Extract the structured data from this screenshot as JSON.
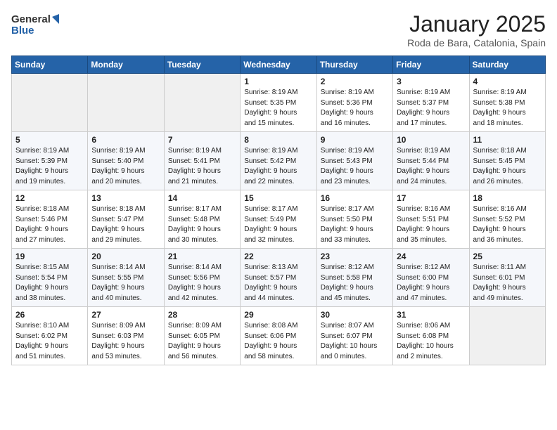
{
  "header": {
    "logo_general": "General",
    "logo_blue": "Blue",
    "month_title": "January 2025",
    "location": "Roda de Bara, Catalonia, Spain"
  },
  "days_of_week": [
    "Sunday",
    "Monday",
    "Tuesday",
    "Wednesday",
    "Thursday",
    "Friday",
    "Saturday"
  ],
  "weeks": [
    [
      {
        "day": "",
        "info": ""
      },
      {
        "day": "",
        "info": ""
      },
      {
        "day": "",
        "info": ""
      },
      {
        "day": "1",
        "info": "Sunrise: 8:19 AM\nSunset: 5:35 PM\nDaylight: 9 hours\nand 15 minutes."
      },
      {
        "day": "2",
        "info": "Sunrise: 8:19 AM\nSunset: 5:36 PM\nDaylight: 9 hours\nand 16 minutes."
      },
      {
        "day": "3",
        "info": "Sunrise: 8:19 AM\nSunset: 5:37 PM\nDaylight: 9 hours\nand 17 minutes."
      },
      {
        "day": "4",
        "info": "Sunrise: 8:19 AM\nSunset: 5:38 PM\nDaylight: 9 hours\nand 18 minutes."
      }
    ],
    [
      {
        "day": "5",
        "info": "Sunrise: 8:19 AM\nSunset: 5:39 PM\nDaylight: 9 hours\nand 19 minutes."
      },
      {
        "day": "6",
        "info": "Sunrise: 8:19 AM\nSunset: 5:40 PM\nDaylight: 9 hours\nand 20 minutes."
      },
      {
        "day": "7",
        "info": "Sunrise: 8:19 AM\nSunset: 5:41 PM\nDaylight: 9 hours\nand 21 minutes."
      },
      {
        "day": "8",
        "info": "Sunrise: 8:19 AM\nSunset: 5:42 PM\nDaylight: 9 hours\nand 22 minutes."
      },
      {
        "day": "9",
        "info": "Sunrise: 8:19 AM\nSunset: 5:43 PM\nDaylight: 9 hours\nand 23 minutes."
      },
      {
        "day": "10",
        "info": "Sunrise: 8:19 AM\nSunset: 5:44 PM\nDaylight: 9 hours\nand 24 minutes."
      },
      {
        "day": "11",
        "info": "Sunrise: 8:18 AM\nSunset: 5:45 PM\nDaylight: 9 hours\nand 26 minutes."
      }
    ],
    [
      {
        "day": "12",
        "info": "Sunrise: 8:18 AM\nSunset: 5:46 PM\nDaylight: 9 hours\nand 27 minutes."
      },
      {
        "day": "13",
        "info": "Sunrise: 8:18 AM\nSunset: 5:47 PM\nDaylight: 9 hours\nand 29 minutes."
      },
      {
        "day": "14",
        "info": "Sunrise: 8:17 AM\nSunset: 5:48 PM\nDaylight: 9 hours\nand 30 minutes."
      },
      {
        "day": "15",
        "info": "Sunrise: 8:17 AM\nSunset: 5:49 PM\nDaylight: 9 hours\nand 32 minutes."
      },
      {
        "day": "16",
        "info": "Sunrise: 8:17 AM\nSunset: 5:50 PM\nDaylight: 9 hours\nand 33 minutes."
      },
      {
        "day": "17",
        "info": "Sunrise: 8:16 AM\nSunset: 5:51 PM\nDaylight: 9 hours\nand 35 minutes."
      },
      {
        "day": "18",
        "info": "Sunrise: 8:16 AM\nSunset: 5:52 PM\nDaylight: 9 hours\nand 36 minutes."
      }
    ],
    [
      {
        "day": "19",
        "info": "Sunrise: 8:15 AM\nSunset: 5:54 PM\nDaylight: 9 hours\nand 38 minutes."
      },
      {
        "day": "20",
        "info": "Sunrise: 8:14 AM\nSunset: 5:55 PM\nDaylight: 9 hours\nand 40 minutes."
      },
      {
        "day": "21",
        "info": "Sunrise: 8:14 AM\nSunset: 5:56 PM\nDaylight: 9 hours\nand 42 minutes."
      },
      {
        "day": "22",
        "info": "Sunrise: 8:13 AM\nSunset: 5:57 PM\nDaylight: 9 hours\nand 44 minutes."
      },
      {
        "day": "23",
        "info": "Sunrise: 8:12 AM\nSunset: 5:58 PM\nDaylight: 9 hours\nand 45 minutes."
      },
      {
        "day": "24",
        "info": "Sunrise: 8:12 AM\nSunset: 6:00 PM\nDaylight: 9 hours\nand 47 minutes."
      },
      {
        "day": "25",
        "info": "Sunrise: 8:11 AM\nSunset: 6:01 PM\nDaylight: 9 hours\nand 49 minutes."
      }
    ],
    [
      {
        "day": "26",
        "info": "Sunrise: 8:10 AM\nSunset: 6:02 PM\nDaylight: 9 hours\nand 51 minutes."
      },
      {
        "day": "27",
        "info": "Sunrise: 8:09 AM\nSunset: 6:03 PM\nDaylight: 9 hours\nand 53 minutes."
      },
      {
        "day": "28",
        "info": "Sunrise: 8:09 AM\nSunset: 6:05 PM\nDaylight: 9 hours\nand 56 minutes."
      },
      {
        "day": "29",
        "info": "Sunrise: 8:08 AM\nSunset: 6:06 PM\nDaylight: 9 hours\nand 58 minutes."
      },
      {
        "day": "30",
        "info": "Sunrise: 8:07 AM\nSunset: 6:07 PM\nDaylight: 10 hours\nand 0 minutes."
      },
      {
        "day": "31",
        "info": "Sunrise: 8:06 AM\nSunset: 6:08 PM\nDaylight: 10 hours\nand 2 minutes."
      },
      {
        "day": "",
        "info": ""
      }
    ]
  ]
}
